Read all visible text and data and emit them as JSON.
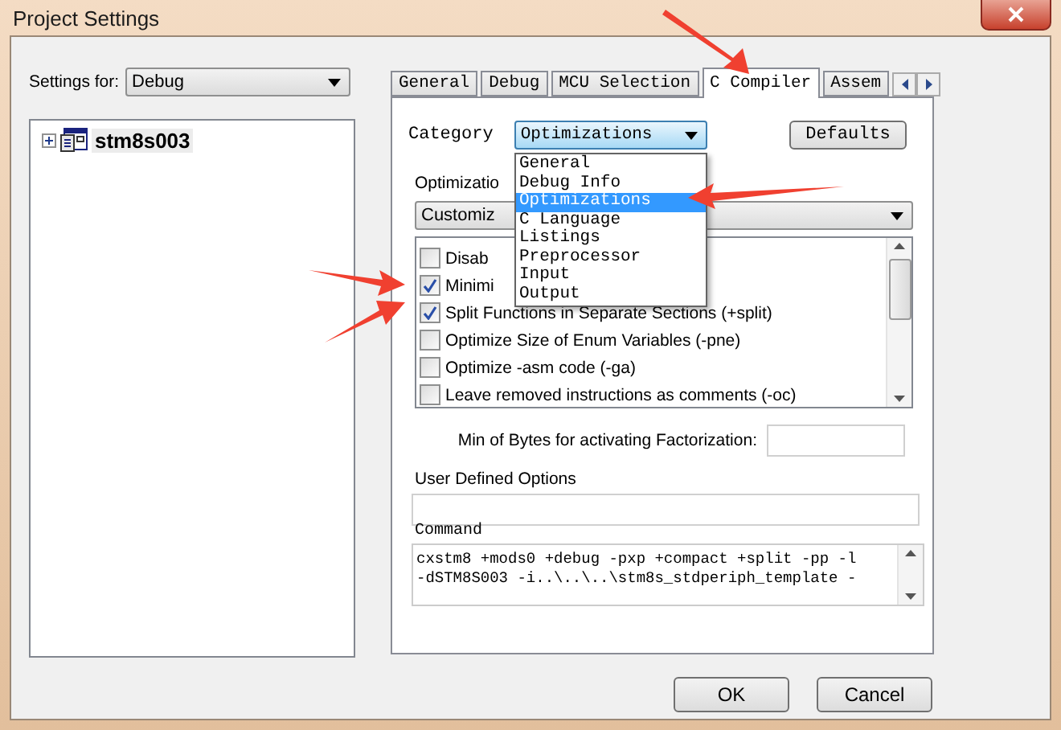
{
  "window": {
    "title": "Project Settings"
  },
  "settings_for": {
    "label": "Settings for:",
    "value": "Debug"
  },
  "tree": [
    {
      "label": "stm8s003",
      "expanded": false
    }
  ],
  "tabs": [
    {
      "label": "General",
      "selected": false
    },
    {
      "label": "Debug",
      "selected": false
    },
    {
      "label": "MCU Selection",
      "selected": false
    },
    {
      "label": "C Compiler",
      "selected": true
    },
    {
      "label": "Assem",
      "selected": false
    }
  ],
  "category": {
    "label": "Category",
    "value": "Optimizations",
    "expanded": true,
    "options": [
      {
        "label": "General",
        "selected": false
      },
      {
        "label": "Debug Info",
        "selected": false
      },
      {
        "label": "Optimizations",
        "selected": true
      },
      {
        "label": "C Language",
        "selected": false
      },
      {
        "label": "Listings",
        "selected": false
      },
      {
        "label": "Preprocessor",
        "selected": false
      },
      {
        "label": "Input",
        "selected": false
      },
      {
        "label": "Output",
        "selected": false
      }
    ]
  },
  "defaults_button": "Defaults",
  "optimization": {
    "label": "Optimizatio",
    "value": "Customiz"
  },
  "options": [
    {
      "label": "Disab",
      "checked": false
    },
    {
      "label": "Minimi",
      "checked": true
    },
    {
      "label": "Split Functions in Separate Sections (+split)",
      "checked": true
    },
    {
      "label": "Optimize Size of Enum Variables (-pne)",
      "checked": false
    },
    {
      "label": "Optimize -asm code (-ga)",
      "checked": false
    },
    {
      "label": "Leave removed instructions as comments (-oc)",
      "checked": false
    }
  ],
  "factorization": {
    "label": "Min of Bytes for activating Factorization:"
  },
  "user_defined": {
    "label": "User Defined Options"
  },
  "command": {
    "label": "Command",
    "lines": [
      "cxstm8 +mods0 +debug -pxp +compact +split -pp -l",
      "-dSTM8S003 -i..\\..\\..\\stm8s_stdperiph_template -"
    ]
  },
  "buttons": [
    "OK",
    "Cancel"
  ]
}
